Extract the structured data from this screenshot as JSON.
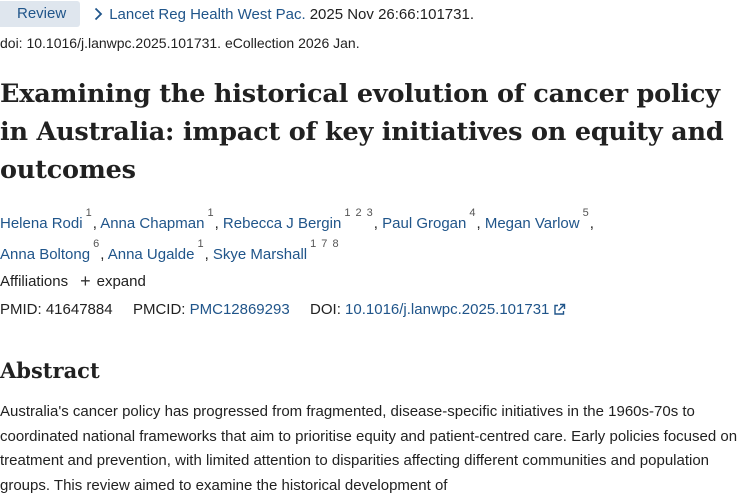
{
  "citation": {
    "pub_type": "Review",
    "journal": "Lancet Reg Health West Pac.",
    "date_volume": "2025 Nov 26:66:101731.",
    "doi_line": "doi: 10.1016/j.lanwpc.2025.101731. eCollection 2026 Jan."
  },
  "article": {
    "title": "Examining the historical evolution of cancer policy in Australia: impact of key initiatives on equity and outcomes"
  },
  "authors": [
    {
      "name": "Helena Rodi",
      "affs": "1"
    },
    {
      "name": "Anna Chapman",
      "affs": "1"
    },
    {
      "name": "Rebecca J Bergin",
      "affs": "1 2 3"
    },
    {
      "name": "Paul Grogan",
      "affs": "4"
    },
    {
      "name": "Megan Varlow",
      "affs": "5"
    },
    {
      "name": "Anna Boltong",
      "affs": "6"
    },
    {
      "name": "Anna Ugalde",
      "affs": "1"
    },
    {
      "name": "Skye Marshall",
      "affs": "1 7 8"
    }
  ],
  "affiliations": {
    "label": "Affiliations",
    "expand_label": "expand"
  },
  "identifiers": {
    "pmid_label": "PMID:",
    "pmid": "41647884",
    "pmcid_label": "PMCID:",
    "pmcid": "PMC12869293",
    "doi_label": "DOI:",
    "doi": "10.1016/j.lanwpc.2025.101731"
  },
  "abstract": {
    "heading": "Abstract",
    "text": "Australia's cancer policy has progressed from fragmented, disease-specific initiatives in the 1960s-70s to coordinated national frameworks that aim to prioritise equity and patient-centred care. Early policies focused on treatment and prevention, with limited attention to disparities affecting different communities and population groups. This review aimed to examine the historical development of"
  },
  "colors": {
    "link": "#20558a",
    "badge_bg": "#dfe6ee",
    "text": "#212121"
  },
  "icons": [
    "chevron-right-icon",
    "plus-icon",
    "external-link-icon"
  ]
}
